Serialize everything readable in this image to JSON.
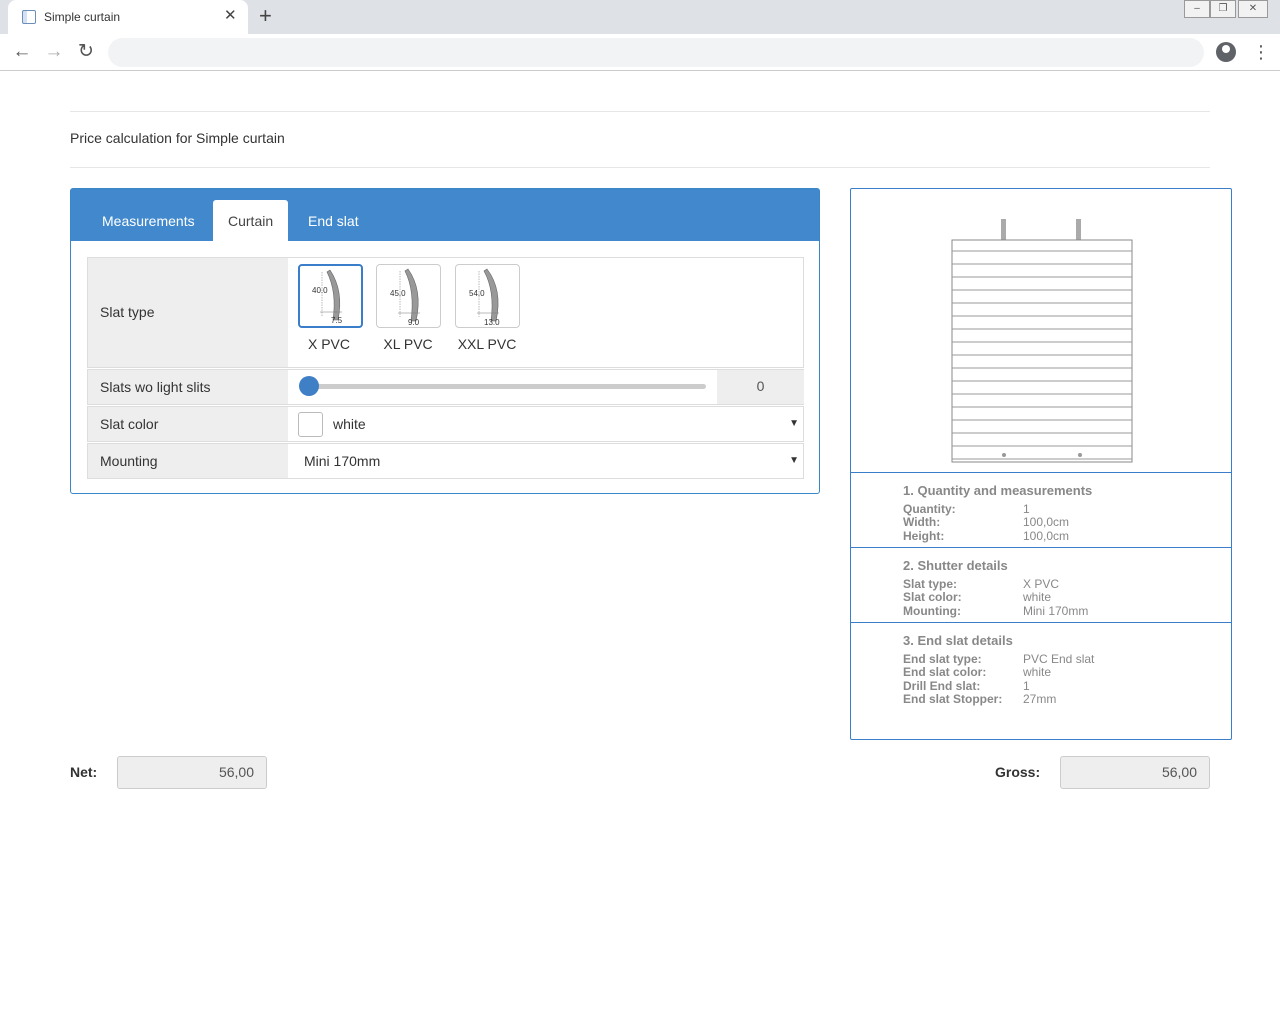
{
  "browser": {
    "tab_title": "Simple curtain",
    "tab_close": "✕",
    "new_tab": "+",
    "url": ""
  },
  "page": {
    "title": "Price calculation for Simple curtain"
  },
  "tabs": [
    {
      "label": "Measurements",
      "active": false
    },
    {
      "label": "Curtain",
      "active": true
    },
    {
      "label": "End slat",
      "active": false
    }
  ],
  "form": {
    "slat_type": {
      "label": "Slat type",
      "options": [
        {
          "name": "X PVC",
          "height": "40.0",
          "thickness": "7.5",
          "selected": true
        },
        {
          "name": "XL PVC",
          "height": "45.0",
          "thickness": "9.0",
          "selected": false
        },
        {
          "name": "XXL PVC",
          "height": "54.0",
          "thickness": "13.0",
          "selected": false
        }
      ]
    },
    "slats_wo_light_slits": {
      "label": "Slats wo light slits",
      "value": "0",
      "level": 0
    },
    "slat_color": {
      "label": "Slat color",
      "value": "white",
      "swatch": "#ffffff"
    },
    "mounting": {
      "label": "Mounting",
      "value": "Mini 170mm"
    }
  },
  "summary": {
    "sections": [
      {
        "title": "1. Quantity and measurements",
        "rows": [
          {
            "key": "Quantity:",
            "value": "1"
          },
          {
            "key": "Width:",
            "value": "100,0cm"
          },
          {
            "key": "Height:",
            "value": "100,0cm"
          }
        ]
      },
      {
        "title": "2. Shutter details",
        "rows": [
          {
            "key": "Slat type:",
            "value": "X PVC"
          },
          {
            "key": "Slat color:",
            "value": "white"
          },
          {
            "key": "Mounting:",
            "value": "Mini 170mm"
          }
        ]
      },
      {
        "title": "3. End slat details",
        "rows": [
          {
            "key": "End slat type:",
            "value": "PVC End slat"
          },
          {
            "key": "End slat color:",
            "value": "white"
          },
          {
            "key": "Drill End slat:",
            "value": "1"
          },
          {
            "key": "End slat Stopper:",
            "value": "27mm"
          }
        ]
      }
    ]
  },
  "price": {
    "net_label": "Net:",
    "net_value": "56,00",
    "gross_label": "Gross:",
    "gross_value": "56,00"
  },
  "colors": {
    "accent": "#4189cc",
    "border": "#3a7dc8"
  }
}
